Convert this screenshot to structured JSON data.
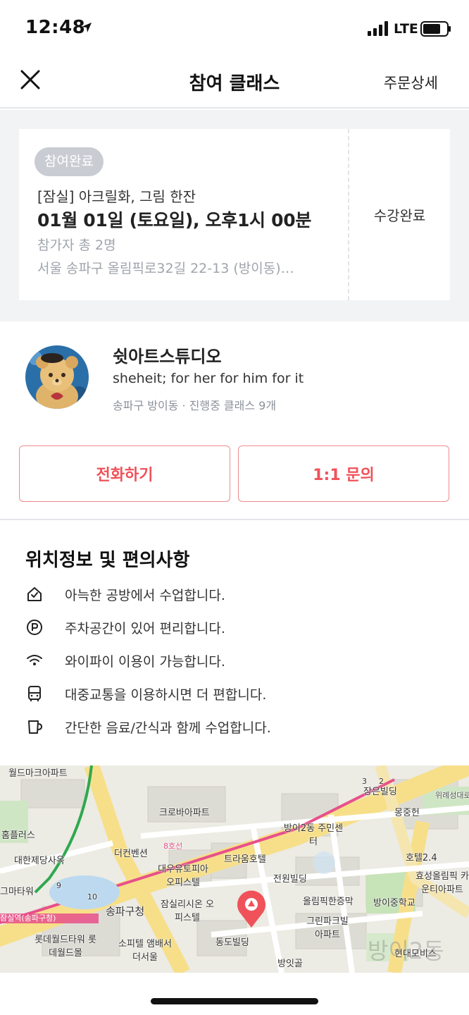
{
  "status_bar": {
    "time": "12:48",
    "network": "LTE"
  },
  "nav": {
    "title": "참여 클래스",
    "action_label": "주문상세"
  },
  "booking": {
    "badge": "참여완료",
    "class_name": "[잠실] 아크릴화, 그림 한잔",
    "datetime": "01월 01일 (토요일), 오후1시 00분",
    "participants": "참가자 총 2명",
    "address": "서울 송파구 올림픽로32길 22-13 (방이동)…",
    "status": "수강완료"
  },
  "studio": {
    "name": "쉿아트스튜디오",
    "slogan": "sheheit; for her for him for it",
    "meta": "송파구 방이동 · 진행중 클래스 9개",
    "call_label": "전화하기",
    "inquiry_label": "1:1 문의"
  },
  "amenities": {
    "title": "위치정보 및 편의사항",
    "items": [
      {
        "icon": "home-icon",
        "text": "아늑한 공방에서 수업합니다."
      },
      {
        "icon": "parking-icon",
        "text": "주차공간이 있어 편리합니다."
      },
      {
        "icon": "wifi-icon",
        "text": "와이파이 이용이 가능합니다."
      },
      {
        "icon": "bus-icon",
        "text": "대중교통을 이용하시면 더 편합니다."
      },
      {
        "icon": "cup-icon",
        "text": "간단한 음료/간식과 함께 수업합니다."
      }
    ]
  },
  "map": {
    "labels": [
      "월드마크아파트",
      "크로바아파트",
      "장은빌딩",
      "몽중헌",
      "홈플러스",
      "대한제당사옥",
      "더컨벤션",
      "방이2동 주민센터",
      "트라움호텔",
      "호텔2.4",
      "대우유토피아 오피스텔",
      "전원빌딩",
      "효성올림픽 카운티아파트",
      "그마타워",
      "송파구청",
      "잠실리시온 오피스텔",
      "올림픽한증막",
      "방이중학교",
      "롯데월드타워 롯데월드몰",
      "그린파크빌 아파트",
      "소피텔 앰배서더서울",
      "동도빌딩",
      "방잇골",
      "현대모비스",
      "8호선",
      "잠실역(송파구청)",
      "위례성대로",
      "9",
      "10",
      "3",
      "2"
    ],
    "watermark": "방이2동"
  },
  "colors": {
    "accent": "#f0525a",
    "badge": "#c9ccd3",
    "subtext": "#a0a4ab"
  }
}
